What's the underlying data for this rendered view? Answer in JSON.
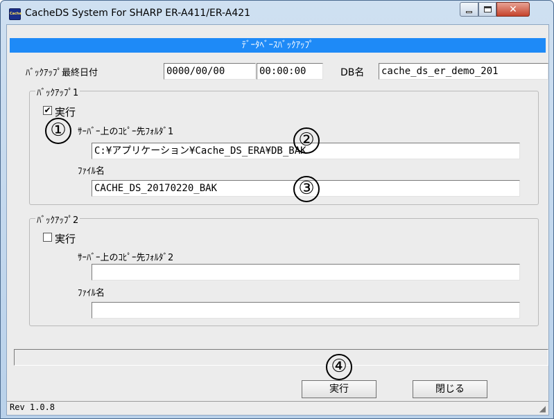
{
  "window": {
    "title": "CacheDS System For SHARP ER-A411/ER-A421",
    "icon_text": "Cache"
  },
  "header": {
    "title": "ﾃﾞｰﾀﾍﾞｰｽﾊﾞｯｸｱｯﾌﾟ"
  },
  "backup_info": {
    "last_date_label": "ﾊﾞｯｸｱｯﾌﾟ最終日付",
    "last_date": "0000/00/00",
    "last_time": "00:00:00",
    "db_name_label": "DB名",
    "db_name": "cache_ds_er_demo_201"
  },
  "backup1": {
    "legend": "ﾊﾞｯｸｱｯﾌﾟ1",
    "execute_label": "実行",
    "execute_checked": true,
    "check_mark": "✔",
    "folder_label": "ｻｰﾊﾞｰ上のｺﾋﾟｰ先ﾌｫﾙﾀﾞ1",
    "folder_value": "C:¥アプリケーション¥Cache_DS_ERA¥DB_BAK",
    "file_label": "ﾌｧｲﾙ名",
    "file_value": "CACHE_DS_20170220_BAK"
  },
  "backup2": {
    "legend": "ﾊﾞｯｸｱｯﾌﾟ2",
    "execute_label": "実行",
    "execute_checked": false,
    "folder_label": "ｻｰﾊﾞｰ上のｺﾋﾟｰ先ﾌｫﾙﾀﾞ2",
    "folder_value": "",
    "file_label": "ﾌｧｲﾙ名",
    "file_value": ""
  },
  "markers": [
    "①",
    "②",
    "③",
    "④"
  ],
  "buttons": {
    "execute": "実行",
    "close": "閉じる"
  },
  "status": {
    "version": "Rev 1.0.8"
  },
  "colors": {
    "header_band": "#1e8af7",
    "close_button": "#c5442c"
  }
}
